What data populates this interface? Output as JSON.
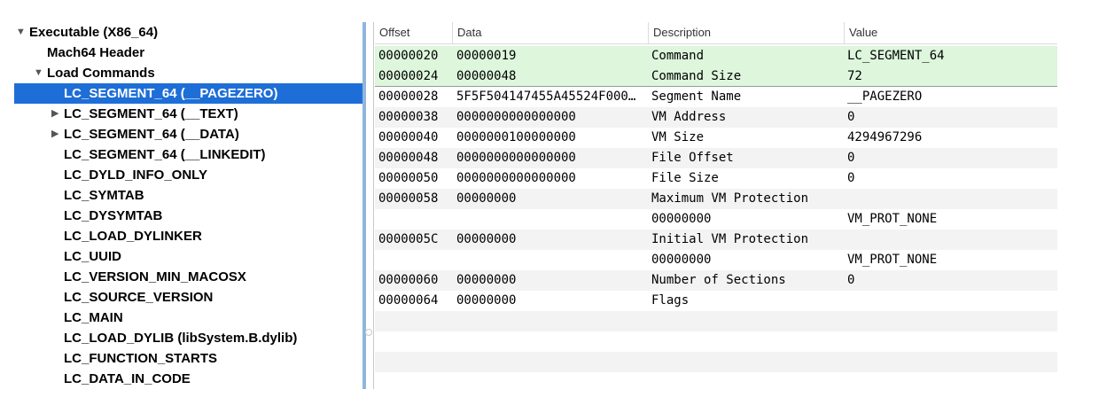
{
  "tree": {
    "items": [
      {
        "label": "Executable  (X86_64)",
        "level": 0,
        "expanded": true,
        "disclosure": "▼"
      },
      {
        "label": "Mach64 Header",
        "level": 1,
        "disclosure": ""
      },
      {
        "label": "Load Commands",
        "level": 1,
        "expanded": true,
        "disclosure": "▼"
      },
      {
        "label": "LC_SEGMENT_64 (__PAGEZERO)",
        "level": 2,
        "selected": true,
        "disclosure": ""
      },
      {
        "label": "LC_SEGMENT_64 (__TEXT)",
        "level": 2,
        "disclosure": "▶"
      },
      {
        "label": "LC_SEGMENT_64 (__DATA)",
        "level": 2,
        "disclosure": "▶"
      },
      {
        "label": "LC_SEGMENT_64 (__LINKEDIT)",
        "level": 2,
        "disclosure": ""
      },
      {
        "label": "LC_DYLD_INFO_ONLY",
        "level": 2,
        "disclosure": ""
      },
      {
        "label": "LC_SYMTAB",
        "level": 2,
        "disclosure": ""
      },
      {
        "label": "LC_DYSYMTAB",
        "level": 2,
        "disclosure": ""
      },
      {
        "label": "LC_LOAD_DYLINKER",
        "level": 2,
        "disclosure": ""
      },
      {
        "label": "LC_UUID",
        "level": 2,
        "disclosure": ""
      },
      {
        "label": "LC_VERSION_MIN_MACOSX",
        "level": 2,
        "disclosure": ""
      },
      {
        "label": "LC_SOURCE_VERSION",
        "level": 2,
        "disclosure": ""
      },
      {
        "label": "LC_MAIN",
        "level": 2,
        "disclosure": ""
      },
      {
        "label": "LC_LOAD_DYLIB (libSystem.B.dylib)",
        "level": 2,
        "disclosure": ""
      },
      {
        "label": "LC_FUNCTION_STARTS",
        "level": 2,
        "disclosure": ""
      },
      {
        "label": "LC_DATA_IN_CODE",
        "level": 2,
        "disclosure": ""
      }
    ]
  },
  "table": {
    "columns": [
      "Offset",
      "Data",
      "Description",
      "Value"
    ],
    "rows": [
      {
        "offset": "00000020",
        "data": "00000019",
        "description": "Command",
        "value": "LC_SEGMENT_64",
        "highlight": true
      },
      {
        "offset": "00000024",
        "data": "00000048",
        "description": "Command Size",
        "value": "72",
        "highlight": true
      },
      {
        "offset": "00000028",
        "data": "5F5F504147455A45524F000…",
        "description": "Segment Name",
        "value": "__PAGEZERO"
      },
      {
        "offset": "00000038",
        "data": "0000000000000000",
        "description": "VM Address",
        "value": "0"
      },
      {
        "offset": "00000040",
        "data": "0000000100000000",
        "description": "VM Size",
        "value": "4294967296"
      },
      {
        "offset": "00000048",
        "data": "0000000000000000",
        "description": "File Offset",
        "value": "0"
      },
      {
        "offset": "00000050",
        "data": "0000000000000000",
        "description": "File Size",
        "value": "0"
      },
      {
        "offset": "00000058",
        "data": "00000000",
        "description": "Maximum VM Protection",
        "value": ""
      },
      {
        "offset": "",
        "data": "",
        "description": "00000000",
        "value": "VM_PROT_NONE"
      },
      {
        "offset": "0000005C",
        "data": "00000000",
        "description": "Initial VM Protection",
        "value": ""
      },
      {
        "offset": "",
        "data": "",
        "description": "00000000",
        "value": "VM_PROT_NONE"
      },
      {
        "offset": "00000060",
        "data": "00000000",
        "description": "Number of Sections",
        "value": "0"
      },
      {
        "offset": "00000064",
        "data": "00000000",
        "description": "Flags",
        "value": ""
      },
      {
        "offset": "",
        "data": "",
        "description": "",
        "value": ""
      },
      {
        "offset": "",
        "data": "",
        "description": "",
        "value": ""
      },
      {
        "offset": "",
        "data": "",
        "description": "",
        "value": ""
      },
      {
        "offset": "",
        "data": "",
        "description": "",
        "value": ""
      }
    ]
  },
  "colors": {
    "selection": "#1e6ed7",
    "highlight_row": "#ddf6dc",
    "alt_row": "#f3f3f3",
    "splitter": "#8fb6dc"
  }
}
